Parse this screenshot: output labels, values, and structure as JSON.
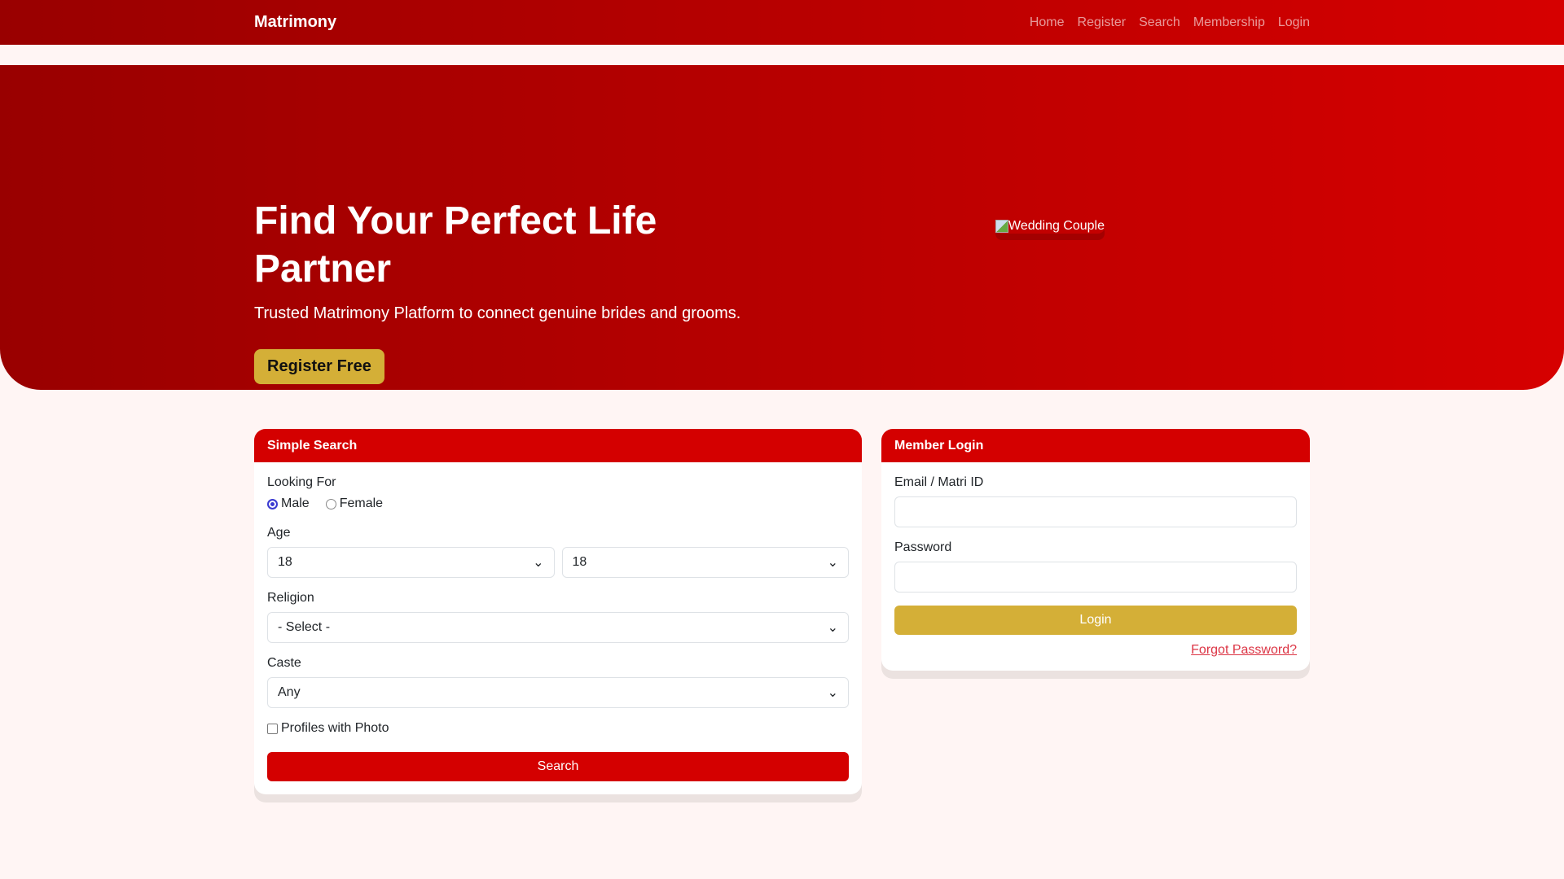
{
  "nav": {
    "brand": "Matrimony",
    "links": [
      "Home",
      "Register",
      "Search",
      "Membership",
      "Login"
    ]
  },
  "hero": {
    "title": "Find Your Perfect Life Partner",
    "subtitle": "Trusted Matrimony Platform to connect genuine brides and grooms.",
    "cta": "Register Free",
    "image_alt": "Wedding Couple"
  },
  "search": {
    "title": "Simple Search",
    "looking_for": "Looking For",
    "male": "Male",
    "female": "Female",
    "age": "Age",
    "age_from": "18",
    "age_to": "18",
    "religion": "Religion",
    "religion_value": "- Select -",
    "caste": "Caste",
    "caste_value": "Any",
    "photo": "Profiles with Photo",
    "button": "Search"
  },
  "login": {
    "title": "Member Login",
    "email_label": "Email / Matri ID",
    "password_label": "Password",
    "button": "Login",
    "forgot": "Forgot Password?"
  },
  "colors": {
    "primary": "#d40000",
    "gold": "#d4af37"
  }
}
